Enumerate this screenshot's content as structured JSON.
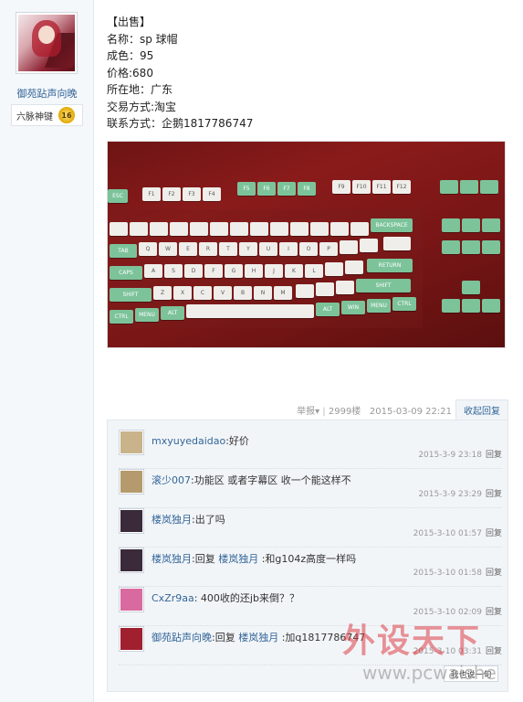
{
  "user": {
    "name": "御苑跕声向晚",
    "rank": "六脉神键",
    "rank_badge": "16"
  },
  "post": {
    "lines": [
      "【出售】",
      "名称：sp 球帽",
      "成色：95",
      "价格:680",
      "所在地：广东",
      "交易方式:淘宝",
      "联系方式：企鹅1817786747"
    ]
  },
  "photo": {
    "description_icon": "keyboard-photo",
    "key_labels": [
      "ESC",
      "F1",
      "F2",
      "F3",
      "F4",
      "F5",
      "F6",
      "F7",
      "F8",
      "F9",
      "F10",
      "F11",
      "F12",
      "BACKSPACE",
      "TAB",
      "Q",
      "W",
      "E",
      "R",
      "T",
      "Y",
      "U",
      "I",
      "O",
      "P",
      "CAPS",
      "A",
      "S",
      "D",
      "F",
      "G",
      "H",
      "J",
      "K",
      "L",
      "RETURN",
      "SHIFT",
      "Z",
      "X",
      "C",
      "V",
      "B",
      "N",
      "M",
      "CTRL",
      "MENU",
      "ALT",
      "WIN"
    ]
  },
  "action_bar": {
    "report": "举报",
    "floor": "2999楼",
    "timestamp": "2015-03-09 22:21",
    "collapse": "收起回复"
  },
  "comments": [
    {
      "user": "mxyuyedaidao",
      "reply_prefix": "",
      "reply_to": "",
      "text": ":好价",
      "time": "2015-3-9 23:18",
      "reply_label": "回复",
      "avatar_color": "#c9b38a"
    },
    {
      "user": "滚少007",
      "reply_prefix": "",
      "reply_to": "",
      "text": ":功能区 或者字幕区 收一个能这样不",
      "time": "2015-3-9 23:29",
      "reply_label": "回复",
      "avatar_color": "#b49a6c"
    },
    {
      "user": "楼岚独月",
      "reply_prefix": "",
      "reply_to": "",
      "text": ":出了吗",
      "time": "2015-3-10 01:57",
      "reply_label": "回复",
      "avatar_color": "#3a2a3a"
    },
    {
      "user": "楼岚独月",
      "reply_prefix": ":回复 ",
      "reply_to": "楼岚独月",
      "text": " :和g104z高度一样吗",
      "time": "2015-3-10 01:58",
      "reply_label": "回复",
      "avatar_color": "#3a2a3a"
    },
    {
      "user": "CxZr9aa",
      "reply_prefix": "",
      "reply_to": "",
      "text": ": 400收的还jb来倒？？",
      "time": "2015-3-10 02:09",
      "reply_label": "回复",
      "avatar_color": "#d86aa0"
    },
    {
      "user": "御苑跕声向晚",
      "reply_prefix": ":回复 ",
      "reply_to": "楼岚独月",
      "text": " :加q1817786747",
      "time": "2015-3-10 03:31",
      "reply_label": "回复",
      "avatar_color": "#a02030"
    }
  ],
  "say_button": "我也说一句",
  "watermark": {
    "big": "外设天下",
    "small": "www.pcwaishe"
  }
}
